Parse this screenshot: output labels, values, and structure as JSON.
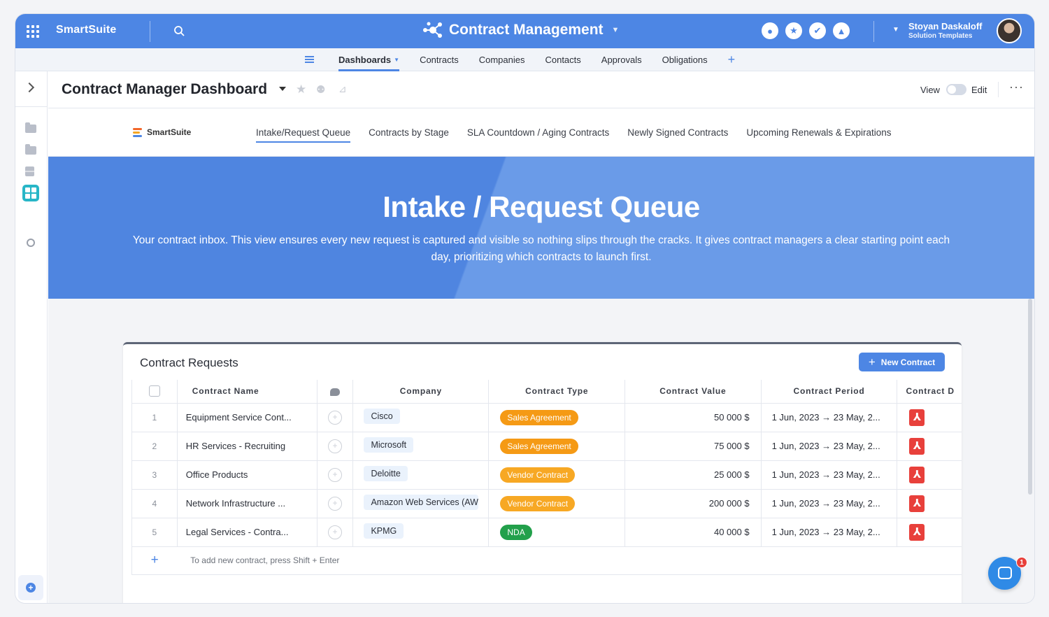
{
  "topbar": {
    "brand": "SmartSuite",
    "app_title": "Contract Management",
    "user_name": "Stoyan Daskaloff",
    "user_role": "Solution Templates",
    "icons": [
      "apps-grid-icon",
      "search-icon",
      "members-icon",
      "star-icon",
      "check-icon",
      "bell-icon"
    ]
  },
  "nav": {
    "items": [
      {
        "label": "Dashboards",
        "active": true
      },
      {
        "label": "Contracts"
      },
      {
        "label": "Companies"
      },
      {
        "label": "Contacts"
      },
      {
        "label": "Approvals"
      },
      {
        "label": "Obligations"
      }
    ],
    "add_label": "+"
  },
  "dashboard": {
    "title": "Contract Manager Dashboard",
    "view_label": "View",
    "edit_label": "Edit",
    "more_label": "···"
  },
  "dash_tabs": {
    "logo_text": "SmartSuite",
    "tabs": [
      {
        "label": "Intake/Request Queue",
        "active": true
      },
      {
        "label": "Contracts by Stage"
      },
      {
        "label": "SLA Countdown / Aging Contracts"
      },
      {
        "label": "Newly Signed Contracts"
      },
      {
        "label": "Upcoming Renewals & Expirations"
      }
    ]
  },
  "hero": {
    "title": "Intake / Request Queue",
    "description": "Your contract inbox. This view ensures every new request is captured and visible so nothing slips through the cracks. It gives contract managers a clear starting point each day, prioritizing which contracts to launch first."
  },
  "widget": {
    "title": "Contract Requests",
    "new_button": "New Contract",
    "new_button_plus": "+",
    "columns": [
      "Contract Name",
      "Company",
      "Contract Type",
      "Contract Value",
      "Contract Period",
      "Contract D"
    ],
    "rows": [
      {
        "num": "1",
        "name": "Equipment Service Cont...",
        "company": "Cisco",
        "type": "Sales Agreement",
        "type_color": "#f59a15",
        "value": "50 000 $",
        "period": "1 Jun, 2023 → 23 May, 2..."
      },
      {
        "num": "2",
        "name": "HR Services - Recruiting",
        "company": "Microsoft",
        "type": "Sales Agreement",
        "type_color": "#f59a15",
        "value": "75 000 $",
        "period": "1 Jun, 2023 → 23 May, 2..."
      },
      {
        "num": "3",
        "name": "Office Products",
        "company": "Deloitte",
        "type": "Vendor Contract",
        "type_color": "#f7a824",
        "value": "25 000 $",
        "period": "1 Jun, 2023 → 23 May, 2..."
      },
      {
        "num": "4",
        "name": "Network Infrastructure ...",
        "company": "Amazon Web Services (AW",
        "type": "Vendor Contract",
        "type_color": "#f7a824",
        "value": "200 000 $",
        "period": "1 Jun, 2023 → 23 May, 2..."
      },
      {
        "num": "5",
        "name": "Legal Services - Contra...",
        "company": "KPMG",
        "type": "NDA",
        "type_color": "#22a04b",
        "value": "40 000 $",
        "period": "1 Jun, 2023 → 23 May, 2..."
      }
    ],
    "add_hint": "To add new contract, press Shift + Enter"
  },
  "chat": {
    "badge": "1"
  }
}
